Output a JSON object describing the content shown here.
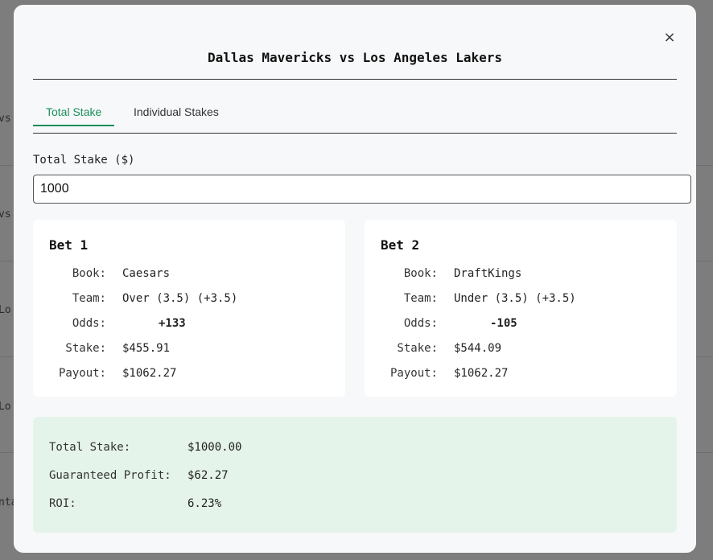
{
  "background": {
    "fragments": [
      "vs",
      "vs",
      "Lo",
      "Lo",
      "nta"
    ]
  },
  "modal": {
    "close_label": "×",
    "title": "Dallas Mavericks vs Los Angeles Lakers"
  },
  "tabs": [
    {
      "label": "Total Stake",
      "active": true
    },
    {
      "label": "Individual Stakes",
      "active": false
    }
  ],
  "stake": {
    "label": "Total Stake ($)",
    "value": "1000"
  },
  "bets": [
    {
      "title": "Bet 1",
      "book_label": "Book:",
      "book": "Caesars",
      "team_label": "Team:",
      "team": "Over (3.5) (+3.5)",
      "odds_label": "Odds:",
      "odds": "+133",
      "stake_label": "Stake:",
      "stake": "$455.91",
      "payout_label": "Payout:",
      "payout": "$1062.27"
    },
    {
      "title": "Bet 2",
      "book_label": "Book:",
      "book": "DraftKings",
      "team_label": "Team:",
      "team": "Under (3.5) (+3.5)",
      "odds_label": "Odds:",
      "odds": "-105",
      "stake_label": "Stake:",
      "stake": "$544.09",
      "payout_label": "Payout:",
      "payout": "$1062.27"
    }
  ],
  "summary": {
    "total_stake_label": "Total Stake:",
    "total_stake": "$1000.00",
    "profit_label": "Guaranteed Profit:",
    "profit": "$62.27",
    "roi_label": "ROI:",
    "roi": "6.23%"
  },
  "colors": {
    "accent": "#1a8f5a",
    "summary_bg": "#e5f4ea",
    "overlay": "#7d7d7d"
  }
}
